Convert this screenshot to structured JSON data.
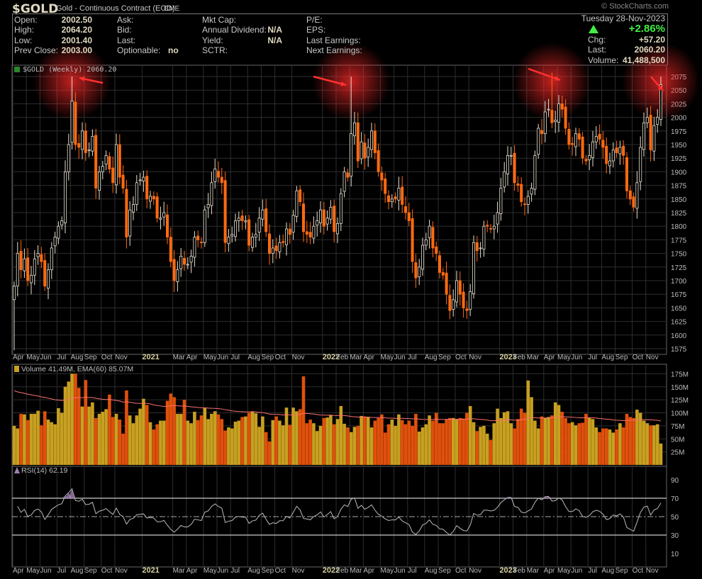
{
  "header": {
    "symbol": "$GOLD",
    "name": "Gold - Continuous Contract (EOD)",
    "exchange": "CME",
    "copyright": "© StockCharts.com",
    "date": "Tuesday  28-Nov-2023",
    "pct_change": "+2.86%",
    "fields": {
      "open_label": "Open:",
      "open": "2002.50",
      "high_label": "High:",
      "high": "2064.20",
      "low_label": "Low:",
      "low": "2001.40",
      "prev_close_label": "Prev Close:",
      "prev_close": "2003.00",
      "ask_label": "Ask:",
      "bid_label": "Bid:",
      "last_label": "Last:",
      "optionable_label": "Optionable:",
      "optionable": "no",
      "mktcap_label": "Mkt Cap:",
      "dividend_label": "Annual Dividend:",
      "dividend": "N/A",
      "yield_label": "Yield:",
      "yield": "N/A",
      "sctr_label": "SCTR:",
      "pe_label": "P/E:",
      "eps_label": "EPS:",
      "last_earn_label": "Last Earnings:",
      "next_earn_label": "Next Earnings:",
      "chg_label": "Chg:",
      "chg": "+57.20",
      "last2_label": "Last:",
      "last2": "2060.20",
      "volume_label": "Volume:",
      "volume": "41,488,500"
    }
  },
  "colors": {
    "up": "#ff7a1a",
    "down": "#ff6a10",
    "vol_up": "#c8a020",
    "vol_down": "#e0500c",
    "ema": "#ff7070",
    "rsi": "#bbbbbb",
    "glow": "#ff2a2a",
    "accent_green": "#44ee44"
  },
  "chart_data": [
    {
      "type": "candlestick",
      "title": "$GOLD (Weekly) 2060.20",
      "ylim": [
        1560,
        2090
      ],
      "yticks": [
        1575,
        1600,
        1625,
        1650,
        1675,
        1700,
        1725,
        1750,
        1775,
        1800,
        1825,
        1850,
        1875,
        1900,
        1925,
        1950,
        1975,
        2000,
        2025,
        2050,
        2075
      ],
      "x_labels": [
        {
          "text": "Apr",
          "week": 0
        },
        {
          "text": "May",
          "week": 4
        },
        {
          "text": "Jun",
          "week": 8
        },
        {
          "text": "Jul",
          "week": 13
        },
        {
          "text": "Aug",
          "week": 17
        },
        {
          "text": "Sep",
          "week": 21
        },
        {
          "text": "Oct",
          "week": 26
        },
        {
          "text": "Nov",
          "week": 30
        },
        {
          "text": "2021",
          "week": 38,
          "year": true
        },
        {
          "text": "Mar",
          "week": 47
        },
        {
          "text": "Apr",
          "week": 51
        },
        {
          "text": "May",
          "week": 56
        },
        {
          "text": "Jun",
          "week": 60
        },
        {
          "text": "Jul",
          "week": 64
        },
        {
          "text": "Aug",
          "week": 69
        },
        {
          "text": "Sep",
          "week": 73
        },
        {
          "text": "Oct",
          "week": 77
        },
        {
          "text": "Nov",
          "week": 82
        },
        {
          "text": "2022",
          "week": 91,
          "year": true
        },
        {
          "text": "Feb",
          "week": 95
        },
        {
          "text": "Mar",
          "week": 99
        },
        {
          "text": "Apr",
          "week": 103
        },
        {
          "text": "May",
          "week": 108
        },
        {
          "text": "Jun",
          "week": 112
        },
        {
          "text": "Jul",
          "week": 116
        },
        {
          "text": "Aug",
          "week": 121
        },
        {
          "text": "Sep",
          "week": 125
        },
        {
          "text": "Oct",
          "week": 130
        },
        {
          "text": "Nov",
          "week": 134
        },
        {
          "text": "2023",
          "week": 143,
          "year": true
        },
        {
          "text": "Feb",
          "week": 147
        },
        {
          "text": "Mar",
          "week": 151
        },
        {
          "text": "Apr",
          "week": 156
        },
        {
          "text": "May",
          "week": 160
        },
        {
          "text": "Jun",
          "week": 164
        },
        {
          "text": "Jul",
          "week": 169
        },
        {
          "text": "Aug",
          "week": 173
        },
        {
          "text": "Sep",
          "week": 177
        },
        {
          "text": "Oct",
          "week": 182
        },
        {
          "text": "Nov",
          "week": 186
        }
      ],
      "highlight_weeks": [
        17,
        99,
        158,
        190
      ],
      "peak_highs": {
        "17": 2075,
        "99": 2075,
        "158": 2082,
        "190": 2075
      },
      "close": [
        1690,
        1750,
        1720,
        1740,
        1700,
        1710,
        1740,
        1750,
        1735,
        1690,
        1720,
        1760,
        1780,
        1800,
        1810,
        1900,
        1950,
        2030,
        1950,
        1945,
        1975,
        1935,
        1940,
        1965,
        1870,
        1900,
        1910,
        1930,
        1905,
        1880,
        1950,
        1890,
        1870,
        1780,
        1830,
        1840,
        1880,
        1885,
        1890,
        1850,
        1855,
        1850,
        1815,
        1815,
        1825,
        1780,
        1735,
        1700,
        1720,
        1745,
        1730,
        1730,
        1745,
        1780,
        1775,
        1770,
        1830,
        1840,
        1880,
        1905,
        1890,
        1880,
        1770,
        1780,
        1785,
        1810,
        1815,
        1810,
        1810,
        1765,
        1780,
        1785,
        1815,
        1830,
        1790,
        1750,
        1760,
        1755,
        1770,
        1770,
        1795,
        1785,
        1820,
        1865,
        1845,
        1790,
        1785,
        1780,
        1800,
        1810,
        1830,
        1800,
        1815,
        1835,
        1790,
        1805,
        1860,
        1900,
        1890,
        1970,
        1990,
        1920,
        1955,
        1925,
        1945,
        1975,
        1935,
        1900,
        1885,
        1860,
        1845,
        1850,
        1850,
        1870,
        1840,
        1825,
        1810,
        1735,
        1705,
        1725,
        1765,
        1775,
        1800,
        1760,
        1750,
        1715,
        1710,
        1675,
        1645,
        1665,
        1700,
        1675,
        1650,
        1645,
        1680,
        1770,
        1755,
        1760,
        1800,
        1800,
        1795,
        1800,
        1825,
        1870,
        1900,
        1930,
        1930,
        1880,
        1875,
        1845,
        1840,
        1855,
        1870,
        1930,
        1980,
        1970,
        2010,
        2015,
        1990,
        1995,
        2025,
        2015,
        1980,
        1950,
        1950,
        1970,
        1960,
        1925,
        1920,
        1930,
        1955,
        1965,
        1960,
        1945,
        1915,
        1920,
        1940,
        1935,
        1945,
        1930,
        1865,
        1850,
        1835,
        1880,
        1945,
        1990,
        2000,
        1940,
        1985,
        2000,
        2060.2
      ]
    },
    {
      "type": "bar",
      "title": "Volume 41.49M, EMA(60) 85.07M",
      "unit": "M",
      "ylim": [
        0,
        185
      ],
      "yticks": [
        25,
        50,
        75,
        100,
        125,
        150,
        175
      ],
      "ytick_labels": [
        "25M",
        "50M",
        "75M",
        "100M",
        "125M",
        "150M",
        "175M"
      ],
      "ema_period": 60,
      "values": [
        75,
        70,
        98,
        97,
        86,
        98,
        98,
        104,
        76,
        103,
        87,
        82,
        78,
        109,
        100,
        150,
        160,
        175,
        175,
        148,
        112,
        163,
        112,
        120,
        90,
        98,
        102,
        107,
        135,
        92,
        98,
        87,
        60,
        143,
        95,
        80,
        95,
        108,
        127,
        115,
        82,
        68,
        78,
        85,
        85,
        123,
        137,
        130,
        98,
        98,
        125,
        85,
        80,
        102,
        86,
        95,
        109,
        88,
        98,
        103,
        97,
        88,
        66,
        72,
        70,
        83,
        85,
        92,
        93,
        100,
        103,
        99,
        73,
        93,
        63,
        45,
        86,
        93,
        85,
        76,
        110,
        77,
        110,
        103,
        107,
        170,
        80,
        87,
        80,
        65,
        75,
        90,
        91,
        96,
        78,
        88,
        113,
        79,
        72,
        63,
        73,
        75,
        94,
        93,
        92,
        72,
        85,
        90,
        97,
        62,
        78,
        87,
        75,
        97,
        86,
        78,
        85,
        75,
        98,
        64,
        72,
        78,
        95,
        85,
        100,
        80,
        80,
        88,
        90,
        90,
        88,
        90,
        89,
        100,
        113,
        82,
        65,
        73,
        75,
        60,
        48,
        80,
        108,
        90,
        101,
        103,
        80,
        70,
        88,
        108,
        100,
        162,
        130,
        85,
        70,
        93,
        90,
        92,
        95,
        120,
        115,
        102,
        90,
        80,
        82,
        76,
        80,
        81,
        98,
        90,
        88,
        72,
        63,
        70,
        70,
        68,
        62,
        68,
        80,
        72,
        98,
        92,
        90,
        106,
        100,
        85,
        80,
        76,
        76,
        78,
        41
      ]
    },
    {
      "type": "line",
      "title": "RSI(14) 62.19",
      "period": 14,
      "ylim": [
        0,
        100
      ],
      "yticks": [
        10,
        30,
        50,
        70,
        90
      ],
      "levels": [
        30,
        50,
        70
      ]
    }
  ]
}
